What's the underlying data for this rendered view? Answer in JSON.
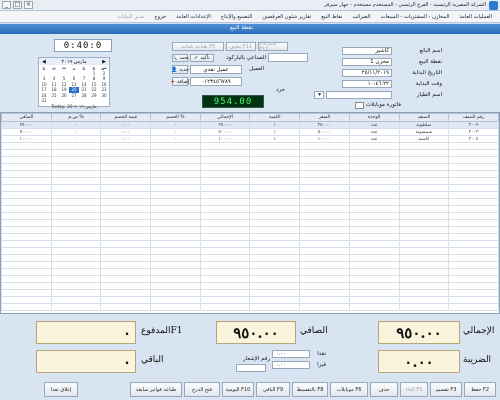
{
  "window": {
    "title": "الشركة المصرية الرئيسية - الفرع الرئيسي - المستخدم مستخدم - جهاز سيرفر",
    "controls": [
      "_",
      "□",
      "×"
    ]
  },
  "menu": [
    "العمليات العامة",
    "المخازن - المشتريات - المبيعات",
    "الضرائب",
    "نقاط البيع",
    "تقارير شئون العرقضين",
    "التصنيع والإنتاج",
    "الإعدادات العامة",
    "خروج"
  ],
  "menu_dim": "مدير البيانات",
  "header": {
    "title": "نقطة البيع"
  },
  "clock": "0:40:0 ",
  "calendar": {
    "month": "مارس ٢٠١٩",
    "days_head": [
      "ح",
      "ن",
      "ث",
      "ر",
      "خ",
      "ج",
      "س"
    ],
    "days": [
      "",
      "",
      "",
      "",
      "",
      "1",
      "2",
      "3",
      "4",
      "5",
      "6",
      "7",
      "8",
      "9",
      "10",
      "11",
      "12",
      "13",
      "14",
      "15",
      "16",
      "17",
      "18",
      "19",
      "20",
      "21",
      "22",
      "23",
      "24",
      "25",
      "26",
      "27",
      "28",
      "29",
      "30",
      "31"
    ],
    "today": "Today: 20 مارس ٢٠١٩"
  },
  "buttons_top": {
    "hold": "تعليق F11",
    "resume": "استرجاع F12",
    "auto_print": "طباعة تلقائية F5",
    "search": "بحث",
    "confirm": "تأكيد",
    "new": "جديد",
    "save": "حفظ",
    "customer_add": "إضافة"
  },
  "form": {
    "item_code_label": "الصناعي بالباركود",
    "customer_label": "العميل",
    "customer_value": "عميل نقدي",
    "phone_value": "٠١٢٣٤٥٦٧٨٩",
    "table_label": "جرد",
    "branch_label": "اسم البائع",
    "branch_value": "كاشير",
    "pos_label": "نقطة البيع",
    "pos_value": "مخزن 1",
    "date_label": "التاريخ البداية",
    "date_value": "٢٥/١١/٢٠١٩",
    "time_label": "وقت البداية",
    "time_value": "١٠:٤٦:٢٢",
    "tax_label": "اسم الطيار",
    "checkbox_label": "فاتورة موبايلات"
  },
  "led": "954.00",
  "table": {
    "headers": [
      "رقم الصنف",
      "الصنف",
      "الوحدة",
      "السعر",
      "الكمية",
      "الإجمالي",
      "الخصم %",
      "قيمة الخصم",
      "ض.م %",
      "الصافي"
    ],
    "rows": [
      [
        "٣٠٠٢",
        "سلطونة",
        "عدد",
        "٣٥٠.٠٠",
        "١",
        "٣٥٠.٠٠",
        "٠",
        "٠.٠٠",
        "٠",
        "٣٥٠.٠٠"
      ],
      [
        "٣٠٠٣",
        "شيبسونة",
        "عدد",
        "٥٠٠.٠٠",
        "١",
        "٥٠٠.٠٠",
        "٠",
        "٠.٠٠",
        "٠",
        "٥٠٠.٠٠"
      ],
      [
        "٣٠٠٤",
        "كاشيه",
        "عدد",
        "١٠٠.٠٠",
        "١",
        "١٠٠.٠٠",
        "٠",
        "٠.٠٠",
        "٠",
        "١٠٠.٠٠"
      ]
    ]
  },
  "totals": {
    "total_label": "الإجمالي",
    "total_value": "٩٥٠.٠٠",
    "net_label": "الصافي",
    "net_value": "٩٥٠.٠٠",
    "paid_label": "المدفوعF1",
    "paid_value": "٠",
    "tax_label": "الضريبة",
    "tax_value": "٠.٠٠",
    "remain_label": "الباقي",
    "remain_value": "٠",
    "notice_label": "رقم الإشعار",
    "cash_label": "نقدا",
    "card_label": "فيزا",
    "cash_value": "٠.٠٠",
    "card_value": "٠.٠٠"
  },
  "fbuttons": [
    "حفظ F2",
    "تقسيم F3",
    "الغاء F5",
    "حذف",
    "موبايلات F6",
    "بالتقسيط F8",
    "الباقي F9",
    "اليومية F10",
    "فتح الدرج",
    "طباعة فواتير سابقة",
    "إغلاق نقدا"
  ]
}
